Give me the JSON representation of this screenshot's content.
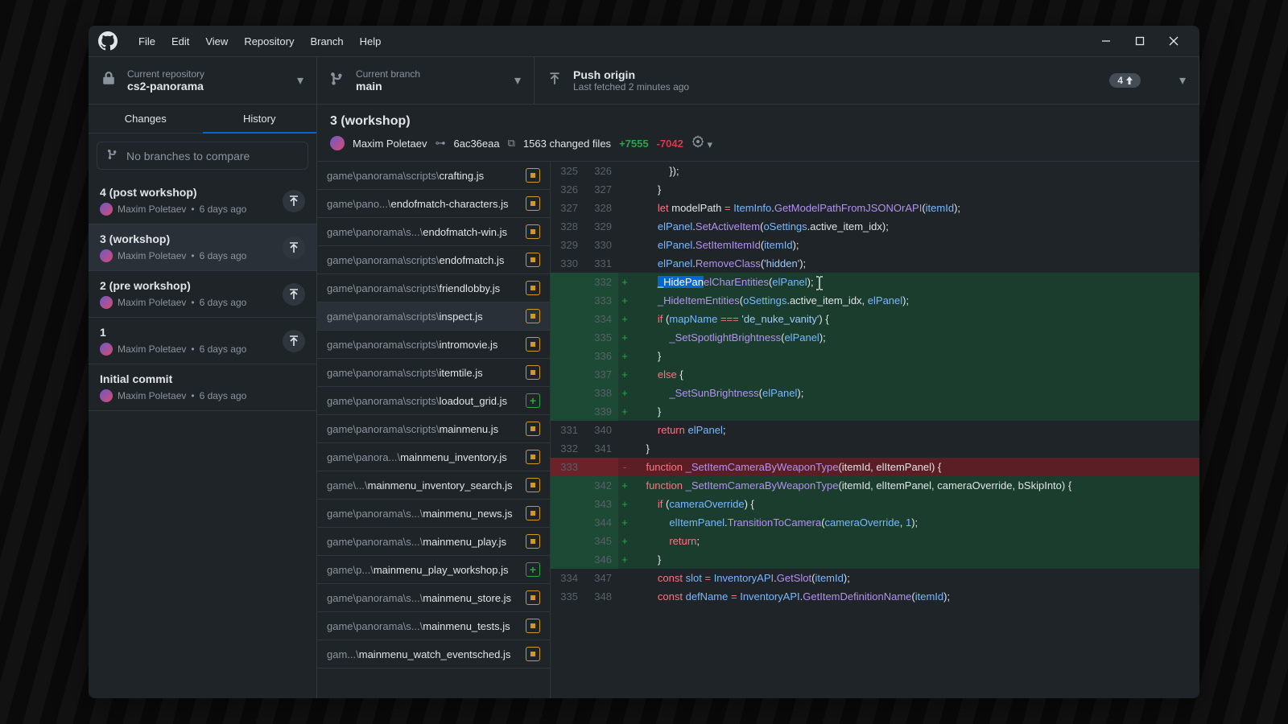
{
  "menu": {
    "file": "File",
    "edit": "Edit",
    "view": "View",
    "repository": "Repository",
    "branch": "Branch",
    "help": "Help"
  },
  "toolbar": {
    "repo": {
      "label": "Current repository",
      "value": "cs2-panorama"
    },
    "branch": {
      "label": "Current branch",
      "value": "main"
    },
    "push": {
      "label": "Push origin",
      "value": "Last fetched 2 minutes ago",
      "badge": "4 "
    }
  },
  "tabs": {
    "changes": "Changes",
    "history": "History"
  },
  "compare": {
    "placeholder": "No branches to compare"
  },
  "commits": [
    {
      "title": "4 (post workshop)",
      "author": "Maxim Poletaev",
      "time": "6 days ago",
      "push": true
    },
    {
      "title": "3 (workshop)",
      "author": "Maxim Poletaev",
      "time": "6 days ago",
      "push": true,
      "selected": true
    },
    {
      "title": "2 (pre workshop)",
      "author": "Maxim Poletaev",
      "time": "6 days ago",
      "push": true
    },
    {
      "title": "1",
      "author": "Maxim Poletaev",
      "time": "6 days ago",
      "push": true
    },
    {
      "title": "Initial commit",
      "author": "Maxim Poletaev",
      "time": "6 days ago"
    }
  ],
  "header": {
    "title": "3 (workshop)",
    "author": "Maxim Poletaev",
    "sha": "6ac36eaa",
    "changed": "1563 changed files",
    "add": "+7555",
    "del": "-7042"
  },
  "files": [
    {
      "prefix": "game\\panorama\\scripts\\",
      "name": "crafting.js",
      "badge": "mod"
    },
    {
      "prefix": "game\\pano...\\",
      "name": "endofmatch-characters.js",
      "badge": "mod"
    },
    {
      "prefix": "game\\panorama\\s...\\",
      "name": "endofmatch-win.js",
      "badge": "mod"
    },
    {
      "prefix": "game\\panorama\\scripts\\",
      "name": "endofmatch.js",
      "badge": "mod"
    },
    {
      "prefix": "game\\panorama\\scripts\\",
      "name": "friendlobby.js",
      "badge": "mod"
    },
    {
      "prefix": "game\\panorama\\scripts\\",
      "name": "inspect.js",
      "badge": "mod",
      "selected": true
    },
    {
      "prefix": "game\\panorama\\scripts\\",
      "name": "intromovie.js",
      "badge": "mod"
    },
    {
      "prefix": "game\\panorama\\scripts\\",
      "name": "itemtile.js",
      "badge": "mod"
    },
    {
      "prefix": "game\\panorama\\scripts\\",
      "name": "loadout_grid.js",
      "badge": "add"
    },
    {
      "prefix": "game\\panorama\\scripts\\",
      "name": "mainmenu.js",
      "badge": "mod"
    },
    {
      "prefix": "game\\panora...\\",
      "name": "mainmenu_inventory.js",
      "badge": "mod"
    },
    {
      "prefix": "game\\...\\",
      "name": "mainmenu_inventory_search.js",
      "badge": "mod"
    },
    {
      "prefix": "game\\panorama\\s...\\",
      "name": "mainmenu_news.js",
      "badge": "mod"
    },
    {
      "prefix": "game\\panorama\\s...\\",
      "name": "mainmenu_play.js",
      "badge": "mod"
    },
    {
      "prefix": "game\\p...\\",
      "name": "mainmenu_play_workshop.js",
      "badge": "add"
    },
    {
      "prefix": "game\\panorama\\s...\\",
      "name": "mainmenu_store.js",
      "badge": "mod"
    },
    {
      "prefix": "game\\panorama\\s...\\",
      "name": "mainmenu_tests.js",
      "badge": "mod"
    },
    {
      "prefix": "gam...\\",
      "name": "mainmenu_watch_eventsched.js",
      "badge": "mod"
    }
  ],
  "diff": [
    {
      "t": "c",
      "o": "325",
      "n": "326",
      "html": "            });"
    },
    {
      "t": "c",
      "o": "326",
      "n": "327",
      "html": "        }"
    },
    {
      "t": "c",
      "o": "327",
      "n": "328",
      "html": "        <span class='tok-kw'>let</span> modelPath <span class='tok-op'>=</span> <span class='tok-var'>ItemInfo</span>.<span class='tok-fn'>GetModelPathFromJSONOrAPI</span>(<span class='tok-var'>itemId</span>);"
    },
    {
      "t": "c",
      "o": "328",
      "n": "329",
      "html": "        <span class='tok-var'>elPanel</span>.<span class='tok-fn'>SetActiveItem</span>(<span class='tok-var'>oSettings</span>.active_item_idx);"
    },
    {
      "t": "c",
      "o": "329",
      "n": "330",
      "html": "        <span class='tok-var'>elPanel</span>.<span class='tok-fn'>SetItemItemId</span>(<span class='tok-var'>itemId</span>);"
    },
    {
      "t": "c",
      "o": "330",
      "n": "331",
      "html": "        <span class='tok-var'>elPanel</span>.<span class='tok-fn'>RemoveClass</span>(<span class='tok-str'>'hidden'</span>);"
    },
    {
      "t": "a",
      "o": "",
      "n": "332",
      "html": "        <span class='sel-text'>_HidePan</span><span class='tok-fn'>elCharEntities</span>(<span class='tok-var'>elPanel</span>);",
      "cursor": true
    },
    {
      "t": "a",
      "o": "",
      "n": "333",
      "html": "        <span class='tok-fn'>_HideItemEntities</span>(<span class='tok-var'>oSettings</span>.active_item_idx, <span class='tok-var'>elPanel</span>);"
    },
    {
      "t": "a",
      "o": "",
      "n": "334",
      "html": "        <span class='tok-kw'>if</span> (<span class='tok-var'>mapName</span> <span class='tok-op'>===</span> <span class='tok-str'>'de_nuke_vanity'</span>) {"
    },
    {
      "t": "a",
      "o": "",
      "n": "335",
      "html": "            <span class='tok-fn'>_SetSpotlightBrightness</span>(<span class='tok-var'>elPanel</span>);"
    },
    {
      "t": "a",
      "o": "",
      "n": "336",
      "html": "        }"
    },
    {
      "t": "a",
      "o": "",
      "n": "337",
      "html": "        <span class='tok-kw'>else</span> {"
    },
    {
      "t": "a",
      "o": "",
      "n": "338",
      "html": "            <span class='tok-fn'>_SetSunBrightness</span>(<span class='tok-var'>elPanel</span>);"
    },
    {
      "t": "a",
      "o": "",
      "n": "339",
      "html": "        }"
    },
    {
      "t": "c",
      "o": "331",
      "n": "340",
      "html": "        <span class='tok-kw'>return</span> <span class='tok-var'>elPanel</span>;"
    },
    {
      "t": "c",
      "o": "332",
      "n": "341",
      "html": "    }"
    },
    {
      "t": "d",
      "o": "333",
      "n": "",
      "html": "    <span class='tok-kw'>function</span> <span class='tok-fn'>_SetItemCameraByWeaponType</span>(itemId, elItemPanel) {"
    },
    {
      "t": "a",
      "o": "",
      "n": "342",
      "html": "    <span class='tok-kw'>function</span> <span class='tok-fn'>_SetItemCameraByWeaponType</span>(itemId, elItemPanel, cameraOverride, bSkipInto) {"
    },
    {
      "t": "a",
      "o": "",
      "n": "343",
      "html": "        <span class='tok-kw'>if</span> (<span class='tok-var'>cameraOverride</span>) {"
    },
    {
      "t": "a",
      "o": "",
      "n": "344",
      "html": "            <span class='tok-var'>elItemPanel</span>.<span class='tok-fn'>TransitionToCamera</span>(<span class='tok-var'>cameraOverride</span>, <span class='tok-var'>1</span>);"
    },
    {
      "t": "a",
      "o": "",
      "n": "345",
      "html": "            <span class='tok-kw'>return</span>;"
    },
    {
      "t": "a",
      "o": "",
      "n": "346",
      "html": "        }"
    },
    {
      "t": "c",
      "o": "334",
      "n": "347",
      "html": "        <span class='tok-kw'>const</span> <span class='tok-var'>slot</span> <span class='tok-op'>=</span> <span class='tok-var'>InventoryAPI</span>.<span class='tok-fn'>GetSlot</span>(<span class='tok-var'>itemId</span>);"
    },
    {
      "t": "c",
      "o": "335",
      "n": "348",
      "html": "        <span class='tok-kw'>const</span> <span class='tok-var'>defName</span> <span class='tok-op'>=</span> <span class='tok-var'>InventoryAPI</span>.<span class='tok-fn'>GetItemDefinitionName</span>(<span class='tok-var'>itemId</span>);"
    }
  ]
}
